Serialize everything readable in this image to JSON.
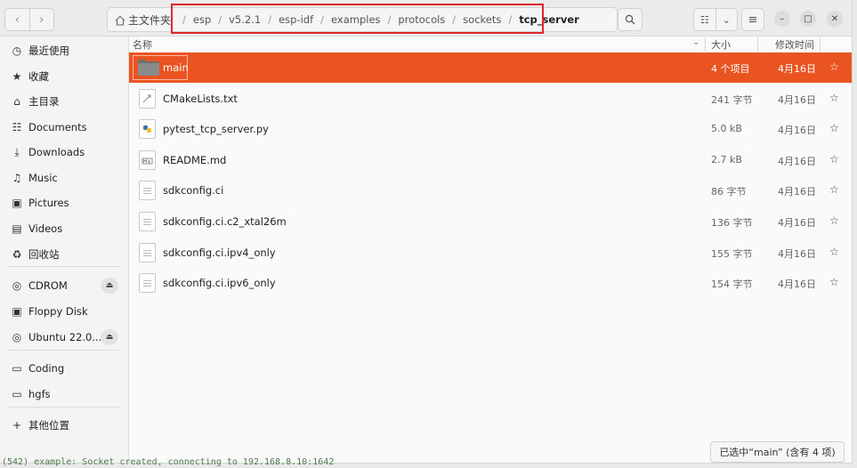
{
  "header": {
    "home_label": "主文件夹",
    "breadcrumbs": [
      "esp",
      "v5.2.1",
      "esp-idf",
      "examples",
      "protocols",
      "sockets",
      "tcp_server"
    ]
  },
  "sidebar": {
    "items": [
      {
        "label": "最近使用",
        "icon": "clock-icon"
      },
      {
        "label": "收藏",
        "icon": "star-icon"
      },
      {
        "label": "主目录",
        "icon": "home-icon"
      },
      {
        "label": "Documents",
        "icon": "document-icon"
      },
      {
        "label": "Downloads",
        "icon": "download-icon"
      },
      {
        "label": "Music",
        "icon": "music-icon"
      },
      {
        "label": "Pictures",
        "icon": "picture-icon"
      },
      {
        "label": "Videos",
        "icon": "video-icon"
      },
      {
        "label": "回收站",
        "icon": "trash-icon"
      },
      {
        "label": "CDROM",
        "icon": "disc-icon"
      },
      {
        "label": "Floppy Disk",
        "icon": "floppy-icon"
      },
      {
        "label": "Ubuntu 22.0...",
        "icon": "disc-icon"
      },
      {
        "label": "Coding",
        "icon": "folder-icon"
      },
      {
        "label": "hgfs",
        "icon": "folder-icon"
      },
      {
        "label": "其他位置",
        "icon": "plus-icon"
      }
    ]
  },
  "columns": {
    "name": "名称",
    "size": "大小",
    "modified": "修改时间"
  },
  "files": [
    {
      "name": "main",
      "size": "4 个项目",
      "date": "4月16日",
      "type": "folder",
      "selected": true
    },
    {
      "name": "CMakeLists.txt",
      "size": "241 字节",
      "date": "4月16日",
      "type": "cmake"
    },
    {
      "name": "pytest_tcp_server.py",
      "size": "5.0 kB",
      "date": "4月16日",
      "type": "python"
    },
    {
      "name": "README.md",
      "size": "2.7 kB",
      "date": "4月16日",
      "type": "markdown"
    },
    {
      "name": "sdkconfig.ci",
      "size": "86 字节",
      "date": "4月16日",
      "type": "text"
    },
    {
      "name": "sdkconfig.ci.c2_xtal26m",
      "size": "136 字节",
      "date": "4月16日",
      "type": "text"
    },
    {
      "name": "sdkconfig.ci.ipv4_only",
      "size": "155 字节",
      "date": "4月16日",
      "type": "text"
    },
    {
      "name": "sdkconfig.ci.ipv6_only",
      "size": "154 字节",
      "date": "4月16日",
      "type": "text"
    }
  ],
  "status": "已选中“main” (含有 4 项)",
  "terminal_line": "(542) example: Socket created, connecting to 192.168.8.10:1642",
  "colors": {
    "accent": "#e95420",
    "highlight_box": "#e0262d"
  }
}
